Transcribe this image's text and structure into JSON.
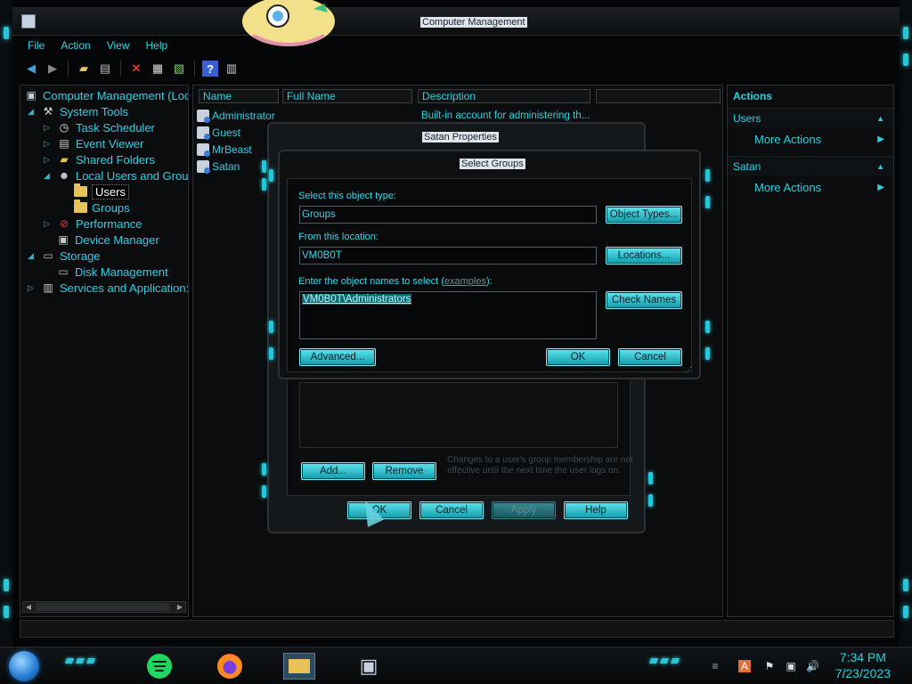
{
  "window": {
    "title": "Computer Management"
  },
  "menu": [
    "File",
    "Action",
    "View",
    "Help"
  ],
  "tree": {
    "root": "Computer Management (Loc",
    "system_tools": "System Tools",
    "task_scheduler": "Task Scheduler",
    "event_viewer": "Event Viewer",
    "shared_folders": "Shared Folders",
    "local_users": "Local Users and Grou",
    "users": "Users",
    "groups": "Groups",
    "performance": "Performance",
    "device_manager": "Device Manager",
    "storage": "Storage",
    "disk_management": "Disk Management",
    "services": "Services and Application:"
  },
  "list": {
    "columns": [
      "Name",
      "Full Name",
      "Description"
    ],
    "rows": [
      {
        "name": "Administrator",
        "full_name": "",
        "description": "Built-in account for administering th..."
      },
      {
        "name": "Guest",
        "full_name": "",
        "description": ""
      },
      {
        "name": "MrBeast",
        "full_name": "",
        "description": ""
      },
      {
        "name": "Satan",
        "full_name": "",
        "description": ""
      }
    ]
  },
  "actions": {
    "header": "Actions",
    "sections": [
      {
        "title": "Users",
        "item": "More Actions"
      },
      {
        "title": "Satan",
        "item": "More Actions"
      }
    ]
  },
  "properties_dialog": {
    "title": "Satan Properties",
    "add_label": "Add...",
    "remove_label": "Remove",
    "note": "Changes to a user's group membership are not effective until the next time the user logs on.",
    "ok_label": "OK",
    "cancel_label": "Cancel",
    "apply_label": "Apply",
    "help_label": "Help"
  },
  "select_groups": {
    "title": "Select Groups",
    "object_type_label": "Select this object type:",
    "object_type_value": "Groups",
    "object_types_button": "Object Types...",
    "location_label": "From this location:",
    "location_value": "VM0B0T",
    "locations_button": "Locations...",
    "names_label_prefix": "Enter the object names to select (",
    "names_label_link": "examples",
    "names_label_suffix": "):",
    "names_value": "VM0B0T\\Administrators",
    "check_names_button": "Check Names",
    "advanced_button": "Advanced...",
    "ok_button": "OK",
    "cancel_button": "Cancel"
  },
  "taskbar": {
    "time": "7:34 PM",
    "date": "7/23/2023"
  },
  "colors": {
    "accent": "#27c6d6",
    "text": "#2fcfe0",
    "background": "#050607"
  }
}
